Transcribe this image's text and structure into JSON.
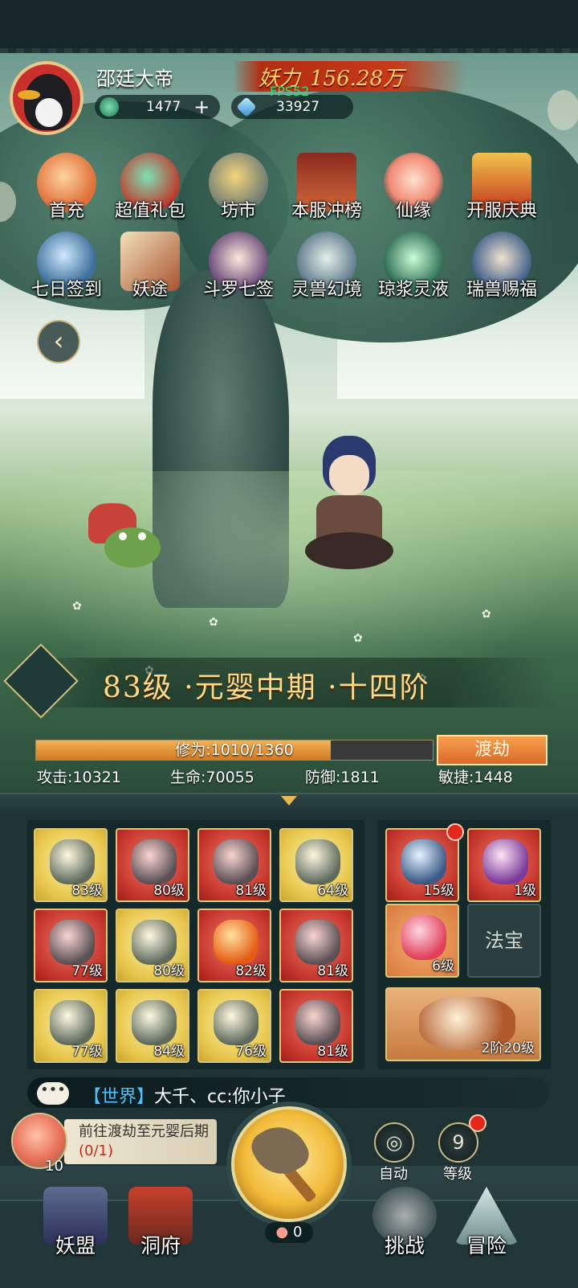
{
  "player": {
    "name": "邵廷大帝",
    "currency_jade": "1477",
    "currency_crystal": "33927",
    "plus": "+"
  },
  "power": {
    "label": "妖力",
    "value": "156.28万"
  },
  "fps": "FPS52",
  "icons_row1": [
    {
      "label": "首充",
      "icon": "gift-pouch-icon"
    },
    {
      "label": "超值礼包",
      "icon": "treasure-bag-icon"
    },
    {
      "label": "坊市",
      "icon": "market-coin-icon"
    },
    {
      "label": "本服冲榜",
      "icon": "ranking-gate-icon"
    },
    {
      "label": "仙缘",
      "icon": "lotus-icon"
    },
    {
      "label": "开服庆典",
      "icon": "celebration-giftbox-icon"
    }
  ],
  "icons_row2": [
    {
      "label": "七日签到",
      "icon": "checkin-orb-icon"
    },
    {
      "label": "妖途",
      "icon": "book-icon"
    },
    {
      "label": "斗罗七签",
      "icon": "girl-character-icon"
    },
    {
      "label": "灵兽幻境",
      "icon": "spirit-beast-icon"
    },
    {
      "label": "琼浆灵液",
      "icon": "elixir-icon"
    },
    {
      "label": "瑞兽赐福",
      "icon": "lucky-beast-icon"
    }
  ],
  "realm": {
    "text": "83级 ·元婴中期 ·十四阶"
  },
  "xp": {
    "text": "修为:1010/1360",
    "current": 1010,
    "max": 1360
  },
  "breakthrough_label": "渡劫",
  "stats": {
    "attack": "攻击:10321",
    "hp": "生命:70055",
    "defense": "防御:1811",
    "agility": "敏捷:1448"
  },
  "equipment": [
    {
      "level": "83级",
      "rarity": "gold",
      "icon": "sword-icon"
    },
    {
      "level": "80级",
      "rarity": "red",
      "icon": "armor-icon"
    },
    {
      "level": "81级",
      "rarity": "red",
      "icon": "robe-icon"
    },
    {
      "level": "64级",
      "rarity": "gold",
      "icon": "helmet-icon"
    },
    {
      "level": "77级",
      "rarity": "red",
      "icon": "belt-icon"
    },
    {
      "level": "80级",
      "rarity": "gold",
      "icon": "bracer-icon"
    },
    {
      "level": "82级",
      "rarity": "red",
      "icon": "orb-icon"
    },
    {
      "level": "81级",
      "rarity": "red",
      "icon": "necklace-icon"
    },
    {
      "level": "77级",
      "rarity": "gold",
      "icon": "boots-icon"
    },
    {
      "level": "84级",
      "rarity": "gold",
      "icon": "warrior-figure-icon"
    },
    {
      "level": "76级",
      "rarity": "gold",
      "icon": "scroll-icon"
    },
    {
      "level": "81级",
      "rarity": "red",
      "icon": "demon-mask-icon"
    }
  ],
  "pets": [
    {
      "level": "15级",
      "icon": "dragon-pet-icon"
    },
    {
      "level": "1级",
      "icon": "fox-spirit-icon"
    },
    {
      "level": "6级",
      "icon": "pink-orb-icon"
    }
  ],
  "fabao_label": "法宝",
  "mount_level": "2阶20级",
  "chat": {
    "channel": "【世界】",
    "message": "大千、cc:你小子",
    "bubble": "•••"
  },
  "quest": {
    "text": "前往渡劫至元婴后期",
    "progress": "(0/1)"
  },
  "peach_count": "10",
  "axe_peach": "0",
  "auto_label": "自动",
  "level_btn": {
    "number": "9",
    "label": "等级"
  },
  "nav": [
    {
      "label": "妖盟",
      "icon": "alliance-tower-icon"
    },
    {
      "label": "洞府",
      "icon": "cave-gate-icon"
    },
    {
      "label": "挑战",
      "icon": "challenge-gourd-icon"
    },
    {
      "label": "冒险",
      "icon": "mountain-adventure-icon"
    }
  ]
}
